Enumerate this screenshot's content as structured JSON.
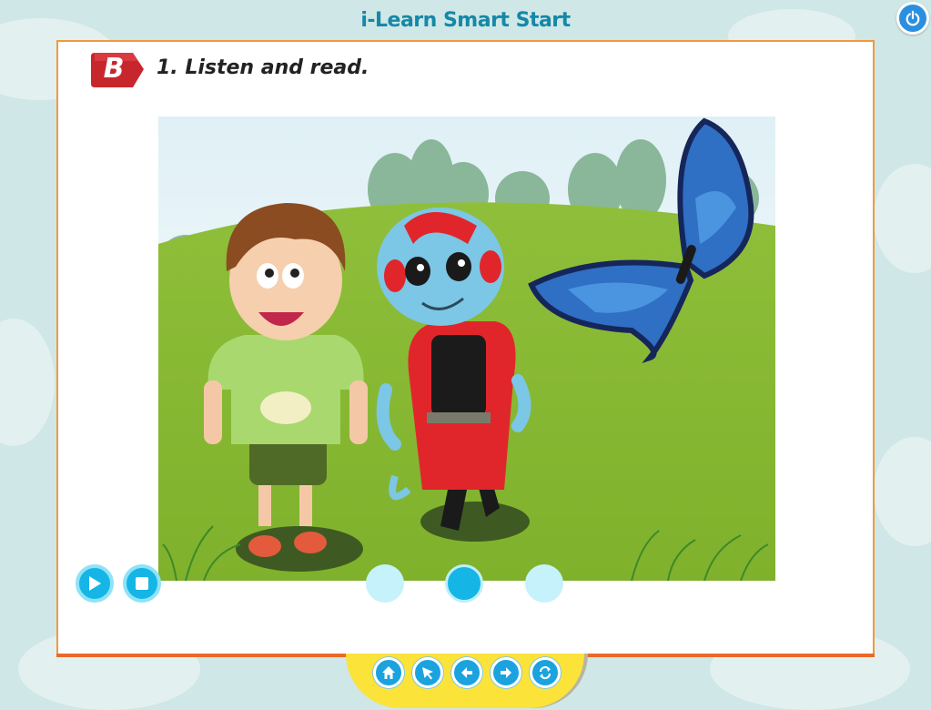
{
  "app": {
    "title": "i-Learn Smart Start"
  },
  "section": {
    "badge": "B",
    "instruction": "1. Listen and read."
  },
  "player": {
    "controls": [
      "play-icon",
      "stop-icon"
    ]
  },
  "pager": {
    "total": 3,
    "active_index": 1
  },
  "nav": {
    "buttons": [
      "home-icon",
      "cursor-icon",
      "arrow-left-icon",
      "arrow-right-icon",
      "refresh-icon"
    ]
  },
  "colors": {
    "accent": "#1588a8",
    "card_border": "#f09a3e",
    "tray": "#fbe33a",
    "button": "#15b6e6"
  }
}
